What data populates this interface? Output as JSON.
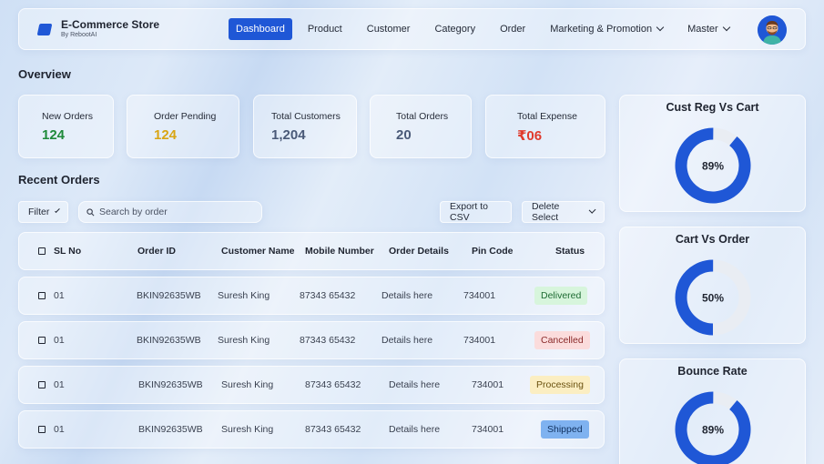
{
  "header": {
    "title": "E-Commerce Store",
    "subtitle": "By RebootAI",
    "nav": [
      {
        "label": "Dashboard",
        "active": true,
        "dropdown": false
      },
      {
        "label": "Product",
        "active": false,
        "dropdown": false
      },
      {
        "label": "Customer",
        "active": false,
        "dropdown": false
      },
      {
        "label": "Category",
        "active": false,
        "dropdown": false
      },
      {
        "label": "Order",
        "active": false,
        "dropdown": false
      },
      {
        "label": "Marketing & Promotion",
        "active": false,
        "dropdown": true
      },
      {
        "label": "Master",
        "active": false,
        "dropdown": true
      }
    ]
  },
  "overview": {
    "title": "Overview",
    "stats": [
      {
        "label": "New Orders",
        "value": "124",
        "color": "#1f8a3a"
      },
      {
        "label": "Order Pending",
        "value": "124",
        "color": "#d9a514"
      },
      {
        "label": "Total Customers",
        "value": "1,204",
        "color": "#4a5a78"
      },
      {
        "label": "Total Orders",
        "value": "20",
        "color": "#4a5a78"
      },
      {
        "label": "Total Expense",
        "value": "₹06",
        "color": "#e0392b"
      }
    ]
  },
  "orders": {
    "title": "Recent Orders",
    "filter_label": "Filter",
    "search_placeholder": "Search by order",
    "export_label": "Export to CSV",
    "delete_label": "Delete Select",
    "columns": [
      "SL No",
      "Order ID",
      "Customer Name",
      "Mobile Number",
      "Order Details",
      "Pin Code",
      "Status"
    ],
    "rows": [
      {
        "sl": "01",
        "order_id": "BKIN92635WB",
        "customer": "Suresh King",
        "mobile": "87343 65432",
        "details": "Details here",
        "pin": "734001",
        "status": "Delivered"
      },
      {
        "sl": "01",
        "order_id": "BKIN92635WB",
        "customer": "Suresh King",
        "mobile": "87343 65432",
        "details": "Details here",
        "pin": "734001",
        "status": "Cancelled"
      },
      {
        "sl": "01",
        "order_id": "BKIN92635WB",
        "customer": "Suresh King",
        "mobile": "87343 65432",
        "details": "Details here",
        "pin": "734001",
        "status": "Processing"
      },
      {
        "sl": "01",
        "order_id": "BKIN92635WB",
        "customer": "Suresh King",
        "mobile": "87343 65432",
        "details": "Details here",
        "pin": "734001",
        "status": "Shipped"
      }
    ],
    "status_colors": {
      "Delivered": {
        "bg": "#d7f5dc",
        "fg": "#1d6b32"
      },
      "Cancelled": {
        "bg": "#fbdcdc",
        "fg": "#8a2a2a"
      },
      "Processing": {
        "bg": "#fbeec2",
        "fg": "#6b5210"
      },
      "Shipped": {
        "bg": "#7fb2f0",
        "fg": "#10305e"
      }
    }
  },
  "metrics": [
    {
      "title": "Cust Reg Vs Cart",
      "percent": 89,
      "label": "89%"
    },
    {
      "title": "Cart Vs Order",
      "percent": 50,
      "label": "50%"
    },
    {
      "title": "Bounce Rate",
      "percent": 89,
      "label": "89%"
    }
  ],
  "colors": {
    "accent": "#1f57d6",
    "ring_track": "#e9edf3"
  }
}
